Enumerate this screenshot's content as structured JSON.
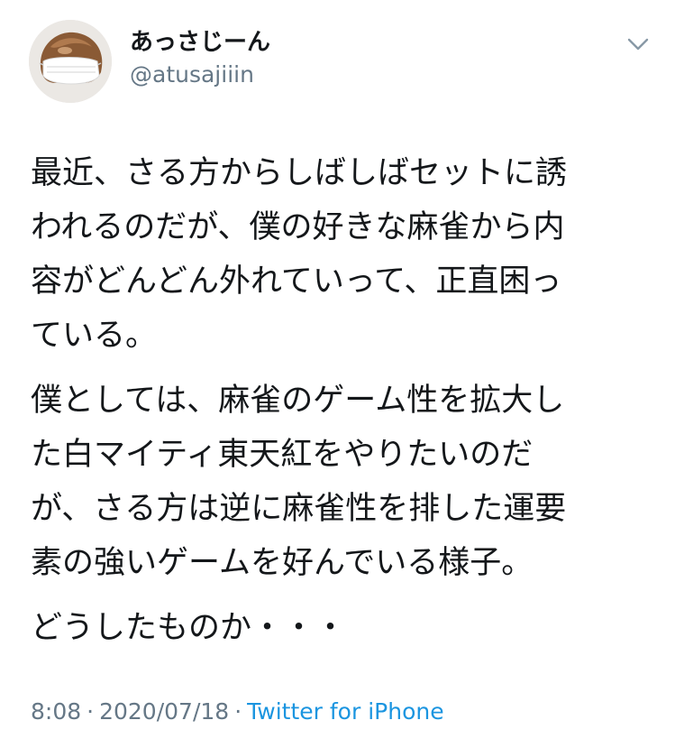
{
  "user": {
    "display_name": "あっさじーん",
    "handle": "@atusajiiin",
    "avatar_icon": "masked-face-avatar"
  },
  "menu": {
    "icon": "chevron-down-icon"
  },
  "tweet": {
    "paragraphs": [
      {
        "lines": [
          "最近、さる方からしばしばセットに誘",
          "われるのだが、僕の好きな麻雀から内",
          "容がどんどん外れていって、正直困っ",
          "ている。"
        ]
      },
      {
        "lines": [
          "僕としては、麻雀のゲーム性を拡大し",
          "た白マイティ東天紅をやりたいのだ",
          "が、さる方は逆に麻雀性を排した運要",
          "素の強いゲームを好んでいる様子。"
        ]
      },
      {
        "lines": [
          "どうしたものか・・・"
        ]
      }
    ]
  },
  "meta": {
    "time": "8:08",
    "date": "2020/07/18",
    "separator": "·",
    "source": "Twitter for iPhone"
  },
  "colors": {
    "text": "#14171a",
    "secondary": "#657786",
    "link": "#1b95e0"
  }
}
